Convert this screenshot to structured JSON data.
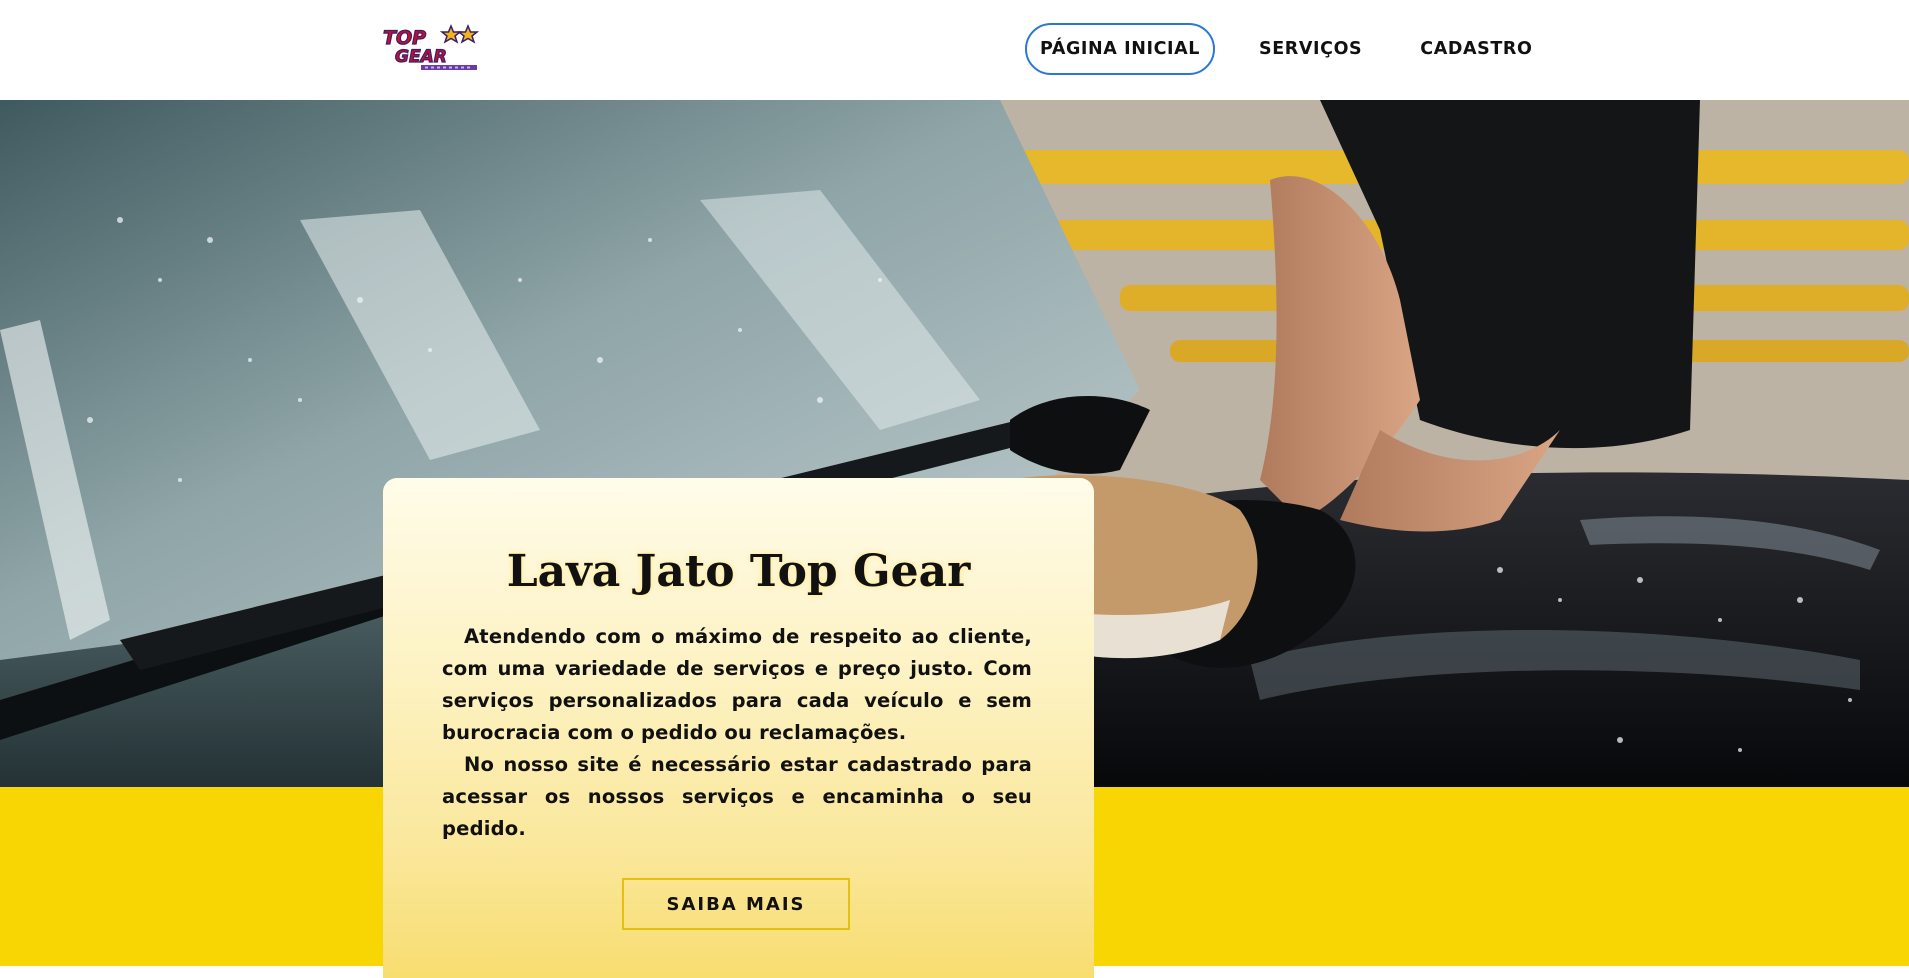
{
  "brand": {
    "logo_text_line1": "TOP",
    "logo_text_line2": "GEAR",
    "colors": {
      "logo_red": "#c4102a",
      "logo_purple": "#3a1d6e",
      "logo_gold": "#f2b518"
    }
  },
  "nav": {
    "items": [
      {
        "label": "PÁGINA INICIAL",
        "active": true
      },
      {
        "label": "SERVIÇOS",
        "active": false
      },
      {
        "label": "CADASTRO",
        "active": false
      }
    ],
    "active_border_color": "#2a78d5"
  },
  "hero": {
    "image_subject": "car-wash-photo"
  },
  "card": {
    "title": "Lava Jato Top Gear",
    "paragraph_1": "Atendendo com o máximo de respeito ao cliente, com uma variedade de serviços e preço justo. Com serviços personalizados para cada veículo e sem burocracia com o pedido ou reclamações.",
    "paragraph_2": "No nosso site é necessário estar cadastrado para acessar os nossos serviços e encaminha o seu pedido.",
    "button_label": "SAIBA MAIS"
  },
  "theme": {
    "yellow": "#f8d603",
    "button_border": "#e7bf10"
  }
}
